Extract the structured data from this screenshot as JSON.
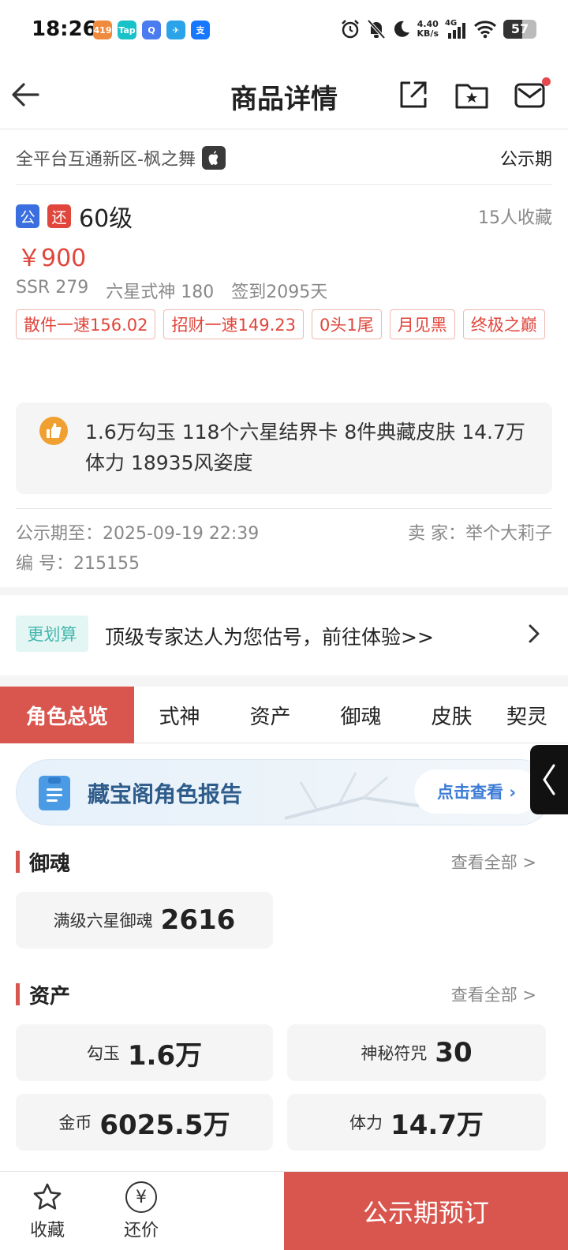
{
  "status_bar": {
    "time": "18:26",
    "net_speed_value": "4.40",
    "net_speed_unit": "KB/s",
    "network": "4G",
    "battery": "57",
    "app_icons": [
      {
        "text": "419",
        "color": "#f08a3c"
      },
      {
        "text": "Tap",
        "color": "#19c2c8"
      },
      {
        "text": "Q",
        "color": "#4a7bef"
      },
      {
        "text": "✈",
        "color": "#2aa3e8"
      },
      {
        "text": "支",
        "color": "#1677ff"
      }
    ]
  },
  "header": {
    "title": "商品详情",
    "icons": [
      "back-icon",
      "share-icon",
      "favorite-folder-icon",
      "mail-icon"
    ]
  },
  "server": {
    "name": "全平台互通新区-枫之舞",
    "status": "公示期"
  },
  "item": {
    "badge_public": "公",
    "badge_bargain": "还",
    "level": "60级",
    "favorites": "15人收藏",
    "price": "￥900",
    "stats": [
      "SSR 279",
      "六星式神 180",
      "签到2095天"
    ],
    "tags": [
      "散件一速156.02",
      "招财一速149.23",
      "0头1尾",
      "月见黑",
      "终极之巅"
    ]
  },
  "highlight": {
    "text": "1.6万勾玉 118个六星结界卡 8件典藏皮肤 14.7万体力 18935风姿度"
  },
  "meta": {
    "public_until": "公示期至：2025-09-19 22:39",
    "seller": "卖 家：举个大莉子",
    "serial": "编 号：215155"
  },
  "expert": {
    "badge": "更划算",
    "text": "顶级专家达人为您估号，前往体验>>"
  },
  "tabs": [
    "角色总览",
    "式神",
    "资产",
    "御魂",
    "皮肤",
    "契灵"
  ],
  "report": {
    "title": "藏宝阁角色报告",
    "button": "点击查看 ›"
  },
  "yuhun": {
    "title": "御魂",
    "more": "查看全部 >",
    "cards": [
      {
        "label": "满级六星御魂",
        "value": "2616"
      }
    ]
  },
  "assets": {
    "title": "资产",
    "more": "查看全部 >",
    "cards": [
      {
        "label": "勾玉",
        "value": "1.6万"
      },
      {
        "label": "神秘符咒",
        "value": "30"
      },
      {
        "label": "金币",
        "value": "6025.5万"
      },
      {
        "label": "体力",
        "value": "14.7万"
      }
    ]
  },
  "bottom_bar": {
    "favorite": "收藏",
    "bargain": "还价",
    "bargain_symbol": "¥",
    "cta": "公示期预订"
  }
}
